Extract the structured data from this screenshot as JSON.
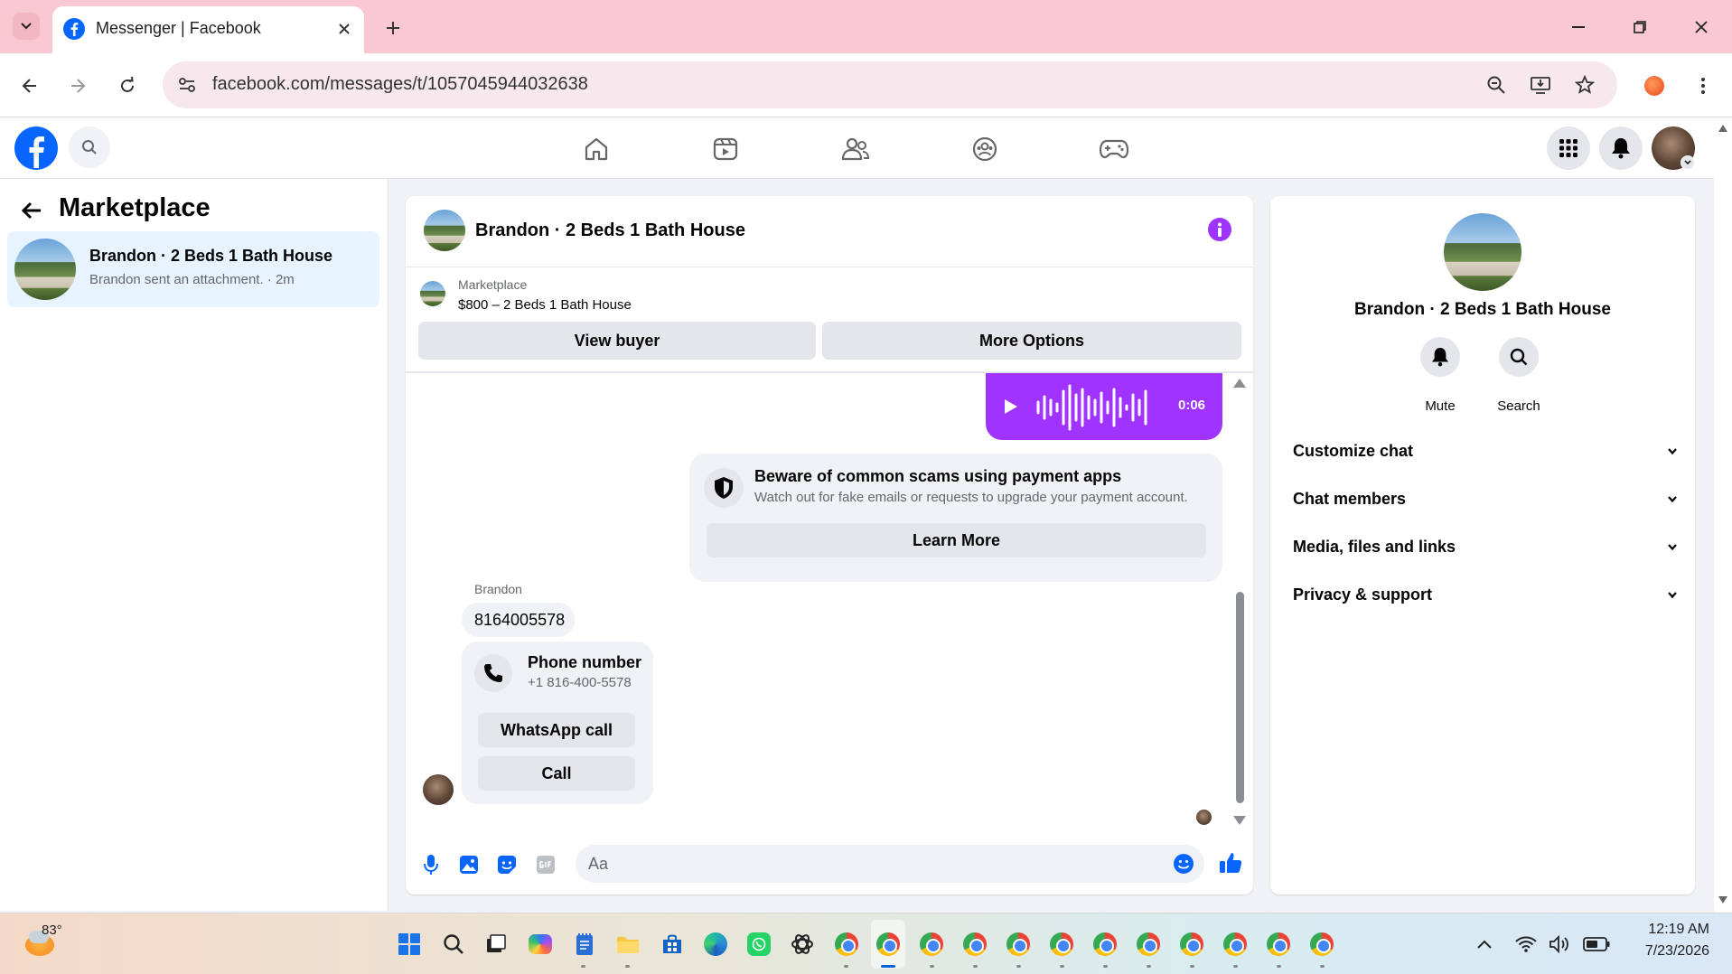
{
  "browser": {
    "tab_title": "Messenger | Facebook",
    "url": "facebook.com/messages/t/1057045944032638"
  },
  "left_panel": {
    "title": "Marketplace",
    "conversations": [
      {
        "name": "Brandon · 2 Beds 1 Bath House",
        "preview": "Brandon sent an attachment. · 2m"
      }
    ]
  },
  "chat": {
    "header_title": "Brandon · 2 Beds 1 Bath House",
    "listing": {
      "label": "Marketplace",
      "title": "$800 – 2 Beds 1 Bath House",
      "view_buyer": "View buyer",
      "more_options": "More Options"
    },
    "voice_message": {
      "duration": "0:06"
    },
    "scam_notice": {
      "title": "Beware of common scams using payment apps",
      "body": "Watch out for fake emails or requests to upgrade your payment account.",
      "button": "Learn More"
    },
    "incoming": {
      "sender": "Brandon",
      "message": "8164005578",
      "phone_card": {
        "title": "Phone number",
        "number": "+1 816-400-5578",
        "whatsapp_button": "WhatsApp call",
        "call_button": "Call"
      }
    },
    "composer": {
      "placeholder": "Aa"
    }
  },
  "info_panel": {
    "name": "Brandon · 2 Beds 1 Bath House",
    "mute_label": "Mute",
    "search_label": "Search",
    "sections": [
      "Customize chat",
      "Chat members",
      "Media, files and links",
      "Privacy & support"
    ]
  },
  "taskbar": {
    "weather_temp": "83°",
    "time": "12:19 AM",
    "date": "7/23/2026"
  },
  "colors": {
    "messenger_purple": "#a033ff",
    "fb_blue": "#0866ff",
    "tab_strip": "#f9c8d2"
  }
}
